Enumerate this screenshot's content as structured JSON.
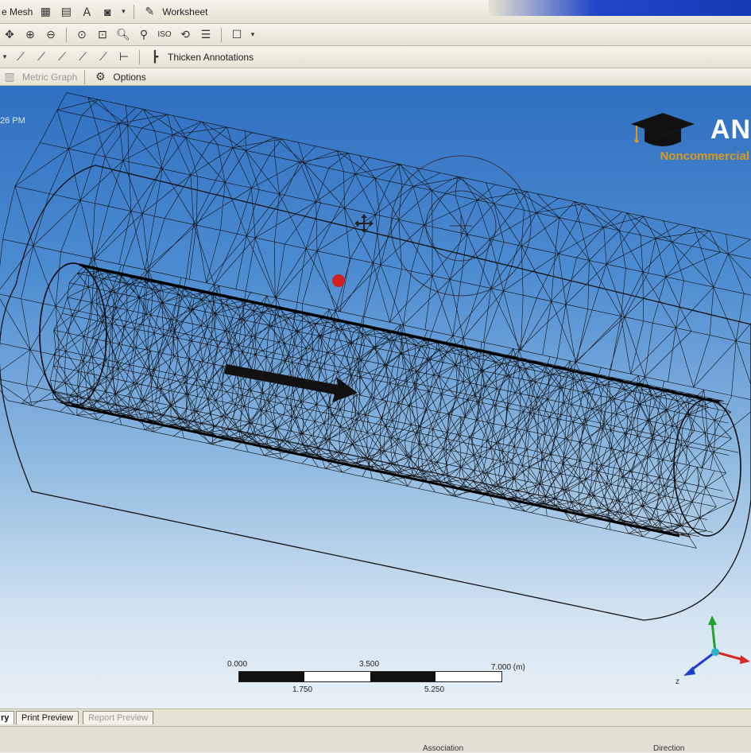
{
  "toolbar1": {
    "mesh_label": "e Mesh",
    "worksheet_label": "Worksheet",
    "icons": [
      "table-icon",
      "tree-icon",
      "text-icon",
      "view-icon",
      "worksheet-icon"
    ]
  },
  "toolbar2": {
    "icons": [
      "pan-icon",
      "zoom-in-icon",
      "zoom-out-icon",
      "zoom-box-icon",
      "zoom-fit-icon",
      "magnify-icon",
      "zoom-icon",
      "iso-icon",
      "rotate-icon",
      "stack-icon",
      "frame-icon"
    ]
  },
  "toolbar3": {
    "thicken_label": "Thicken Annotations"
  },
  "toolbar4": {
    "metric_graph_label": "Metric Graph",
    "options_label": "Options"
  },
  "viewport": {
    "timestamp": "26 PM",
    "brand_name": "AN",
    "brand_sub": "Noncommercial"
  },
  "scale_bar": {
    "top_labels": [
      "0.000",
      "3.500",
      "7.000 (m)"
    ],
    "bottom_labels": [
      "1.750",
      "5.250"
    ]
  },
  "tabs": {
    "geometry_label": "ry",
    "print_preview_label": "Print Preview",
    "report_preview_label": "Report Preview"
  },
  "status": {
    "association_label": "Association",
    "direction_label": "Direction"
  },
  "colors": {
    "viewport_top": "#2f6fc1",
    "viewport_bottom": "#e9f1f7",
    "brand_orange": "#d99a1a",
    "marker_red": "#d21f1f",
    "axis_x": "#d62828",
    "axis_y": "#23a030",
    "axis_z": "#1f3fd0"
  }
}
